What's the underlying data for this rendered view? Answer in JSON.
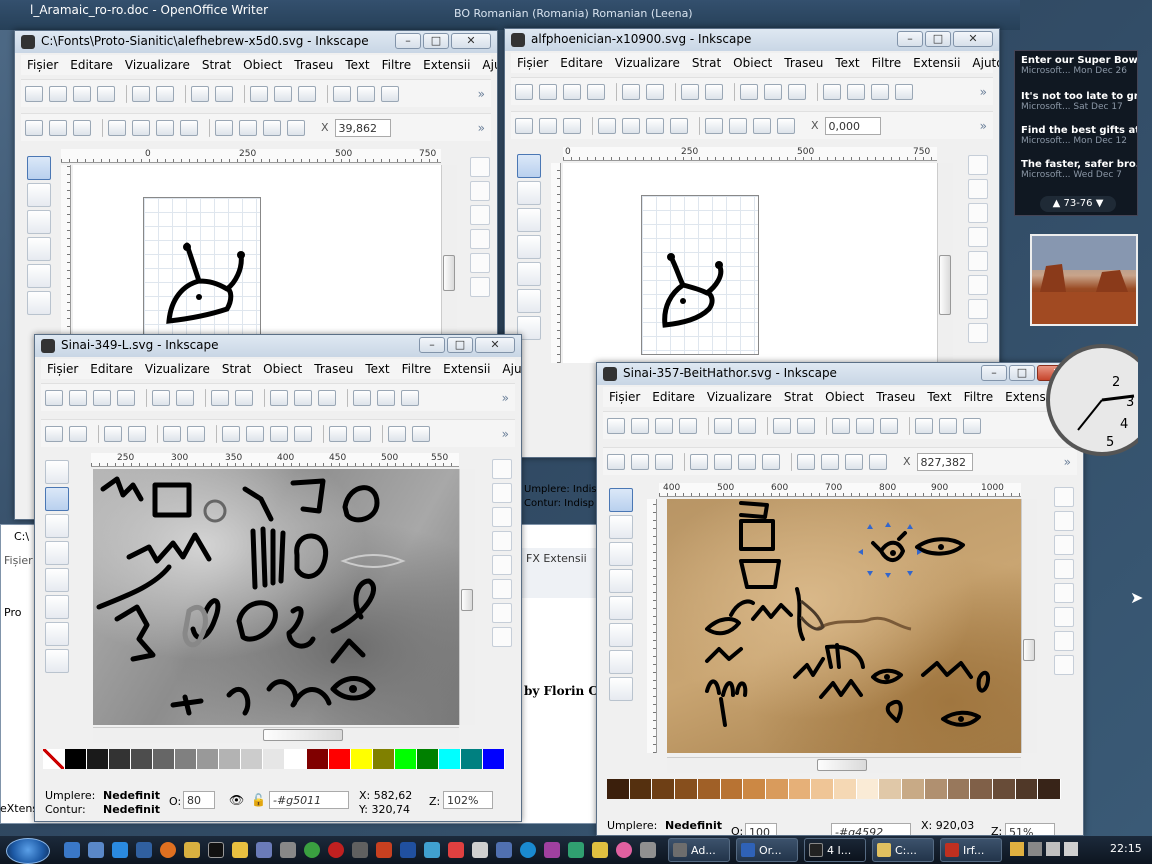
{
  "background_doc": {
    "title": "l_Aramaic_ro-ro.doc - OpenOffice Writer",
    "title2": "BO Romanian (Romania)  Romanian (Leena)",
    "partial_text": "by Florin C",
    "partial_tab": "FX  Extensii",
    "left_fragments": [
      "C:\\",
      "Fișier",
      "Pro",
      "eXtens"
    ],
    "mid_fragments": [
      "Umplere:  Indisp",
      "Contur:  Indisp"
    ]
  },
  "menu": [
    "Fișier",
    "Editare",
    "Vizualizare",
    "Strat",
    "Obiect",
    "Traseu",
    "Text",
    "Filtre",
    "Extensii",
    "Ajutor"
  ],
  "windows": {
    "w1": {
      "title": "C:\\Fonts\\Proto-Sianitic\\alefhebrew-x5d0.svg - Inkscape",
      "x_label": "X",
      "x_value": "39,862",
      "ruler": [
        "0",
        "250",
        "500",
        "750"
      ],
      "vruler": [
        "5",
        "0",
        "0",
        "2",
        "5",
        "0"
      ]
    },
    "w2": {
      "title": "alfphoenician-x10900.svg - Inkscape",
      "x_label": "X",
      "x_value": "0,000",
      "ruler": [
        "0",
        "250",
        "500",
        "750"
      ]
    },
    "w3": {
      "title": "Sinai-349-L.svg - Inkscape",
      "ruler": [
        "250",
        "300",
        "350",
        "400",
        "450",
        "500",
        "550"
      ],
      "fill_label": "Umplere:",
      "fill_value": "Nedefinit",
      "stroke_label": "Contur:",
      "stroke_value": "Nedefinit",
      "opacity_label": "O:",
      "opacity_value": "80",
      "layer": "-#g5011",
      "cursor_x": "X:  582,62",
      "cursor_y": "Y:  320,74",
      "zoom_label": "Z:",
      "zoom_value": "102%"
    },
    "w4": {
      "title": "Sinai-357-BeitHathor.svg - Inkscape",
      "x_label": "X",
      "x_value": "827,382",
      "ruler": [
        "400",
        "500",
        "600",
        "700",
        "800",
        "900",
        "1000"
      ],
      "vruler": [
        "5",
        "0",
        "0",
        "2",
        "5",
        "0"
      ],
      "fill_label": "Umplere:",
      "fill_value": "Nedefinit",
      "opacity_label": "O:",
      "opacity_value": "100",
      "layer": "-#g4592",
      "cursor_x": "X:  920,03",
      "zoom_label": "Z:",
      "zoom_value": "51%"
    }
  },
  "palette_gray": [
    "#ffffff",
    "#000000",
    "#1a1a1a",
    "#333333",
    "#4d4d4d",
    "#666666",
    "#808080",
    "#999999",
    "#b3b3b3",
    "#cccccc",
    "#e6e6e6",
    "#ffffff",
    "#800000",
    "#ff0000",
    "#ffff00",
    "#808000",
    "#00ff00",
    "#008000",
    "#00ffff",
    "#008080",
    "#0000ff"
  ],
  "palette_brown": [
    "#3b1f0c",
    "#55300f",
    "#6e3f15",
    "#874f1d",
    "#a06027",
    "#b87333",
    "#cc8844",
    "#d99b5c",
    "#e6b078",
    "#efc596",
    "#f5d8b4",
    "#faebd6",
    "#e0c8a8",
    "#c8aa86",
    "#b09070",
    "#98785c",
    "#806048",
    "#684c38",
    "#503828",
    "#382418"
  ],
  "news": [
    {
      "headline": "Enter our Super Bowl...",
      "source": "Microsoft...",
      "date": "Mon Dec 26"
    },
    {
      "headline": "It's not too late to gr...",
      "source": "Microsoft...",
      "date": "Sat Dec 17"
    },
    {
      "headline": "Find the best gifts at...",
      "source": "Microsoft...",
      "date": "Mon Dec 12"
    },
    {
      "headline": "The faster, safer bro...",
      "source": "Microsoft...",
      "date": "Wed Dec 7"
    }
  ],
  "news_pager": "73-76",
  "clock_labels": [
    "2",
    "3",
    "4",
    "5"
  ],
  "taskbar": {
    "buttons": [
      {
        "label": "Ad...",
        "color": "#6d6d6d"
      },
      {
        "label": "Or...",
        "color": "#2f62b7"
      },
      {
        "label": "4 I...",
        "color": "#222222"
      },
      {
        "label": "C:...",
        "color": "#e0c060"
      },
      {
        "label": "Irf...",
        "color": "#c03020"
      }
    ],
    "time": "22:15"
  },
  "colors": {
    "titlebar_active": "#c9d6e5",
    "close_red": "#c6452c",
    "stone_gray": "#9a9a9a",
    "stone_tan": "#c9a572",
    "selection_blue": "#3366cc"
  }
}
